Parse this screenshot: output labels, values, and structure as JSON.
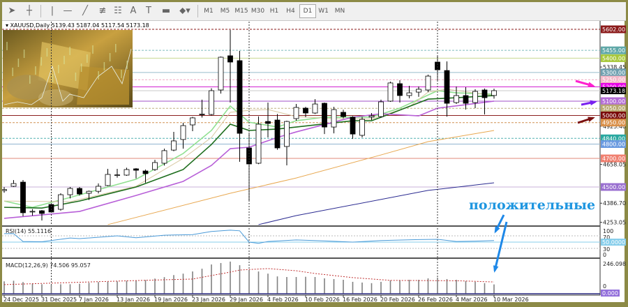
{
  "toolbar": {
    "tools": [
      {
        "icon": "cursor-arrow-icon",
        "glyph": "➤"
      },
      {
        "icon": "crosshair-icon",
        "glyph": "┼"
      },
      {
        "icon": "vertical-line-icon",
        "glyph": "|"
      },
      {
        "icon": "horizontal-line-icon",
        "glyph": "—"
      },
      {
        "icon": "trend-line-icon",
        "glyph": "╱"
      },
      {
        "icon": "fibonacci-channel-icon",
        "glyph": "≢"
      },
      {
        "icon": "fibonacci-grid-icon",
        "glyph": "☷"
      },
      {
        "icon": "text-icon",
        "glyph": "A"
      },
      {
        "icon": "text-label-icon",
        "glyph": "T"
      },
      {
        "icon": "rectangle-icon",
        "glyph": "▬"
      },
      {
        "icon": "shapes-dropdown-icon",
        "glyph": "⬥▾"
      }
    ],
    "timeframes": [
      "M1",
      "M5",
      "M15",
      "M30",
      "H1",
      "H4",
      "D1",
      "W1",
      "MN"
    ],
    "selected_timeframe": "D1"
  },
  "chart_header": {
    "symbol": "XAUUSD,Daily",
    "ohlc": "5139.43 5187.04 5117.54 5173.18"
  },
  "annotation": {
    "text": "положительные",
    "color": "#1e96e0"
  },
  "colors": {
    "bull_fill": "#ffffff",
    "bear_fill": "#000000",
    "candle_stroke": "#000000",
    "background": "#ffffff",
    "frame": "#8c8a46"
  },
  "price_axis": {
    "ticks": [
      "5338.45",
      "4925.40",
      "4658.05",
      "4386.70",
      "4253.05"
    ],
    "current_price": {
      "value": 5173.18,
      "label": "5173.18",
      "color": "#000000",
      "line": "#c8c8c8"
    }
  },
  "levels": [
    {
      "value": 5602,
      "label": "5602.00",
      "color": "#8b1a1a",
      "line": "#8b1a1a",
      "dash": true
    },
    {
      "value": 5455,
      "label": "5455.00",
      "color": "#5fa8a8",
      "line": "#7fbcbc",
      "dash": true
    },
    {
      "value": 5400,
      "label": "5400.00",
      "color": "#a8c83c",
      "line": "#c8d890",
      "dash": false
    },
    {
      "value": 5300,
      "label": "5300.00",
      "color": "#6fa0b0",
      "line": "#98bccb",
      "dash": false
    },
    {
      "value": 5250,
      "label": "5250.00",
      "color": "#f4b8c8",
      "line": "#f0a8c0",
      "dash": true
    },
    {
      "value": 5200,
      "label": "5200.00",
      "color": "#e600e6",
      "line": "#d020d0",
      "dash": false
    },
    {
      "value": 5100,
      "label": "5100.00",
      "color": "#b36bd6",
      "line": "#a050c8",
      "dash": false
    },
    {
      "value": 5050,
      "label": "5050.00",
      "color": "#b8a870",
      "line": "#c0b080",
      "dash": true
    },
    {
      "value": 5000,
      "label": "5000.00",
      "color": "#7a0a0a",
      "line": "#8b2020",
      "dash": false
    },
    {
      "value": 4950,
      "label": "4950.00",
      "color": "#d9904a",
      "line": "#d09050",
      "dash": true
    },
    {
      "value": 4840,
      "label": "4840.00",
      "color": "#2aa8a0",
      "line": "#50b0b0",
      "dash": true
    },
    {
      "value": 4800,
      "label": "4800.00",
      "color": "#6a9ae0",
      "line": "#90b4d0",
      "dash": false
    },
    {
      "value": 4700,
      "label": "4700.00",
      "color": "#f08070",
      "line": "#e08878",
      "dash": false
    },
    {
      "value": 4500,
      "label": "4500.00",
      "color": "#9a70d0",
      "line": "#c8b0d8",
      "dash": false
    }
  ],
  "chart_data": {
    "type": "candlestick",
    "ylim": [
      4253.05,
      5602
    ],
    "date_labels": [
      {
        "date": "2025-12-24",
        "label": "24 Dec 2025"
      },
      {
        "date": "2025-12-31",
        "label": "31 Dec 2025"
      },
      {
        "date": "2026-01-07",
        "label": "7 Jan 2026"
      },
      {
        "date": "2026-01-13",
        "label": "13 Jan 2026"
      },
      {
        "date": "2026-01-19",
        "label": "19 Jan 2026"
      },
      {
        "date": "2026-01-23",
        "label": "23 Jan 2026"
      },
      {
        "date": "2026-01-29",
        "label": "29 Jan 2026"
      },
      {
        "date": "2026-02-04",
        "label": "4 Feb 2026"
      },
      {
        "date": "2026-02-10",
        "label": "10 Feb 2026"
      },
      {
        "date": "2026-02-16",
        "label": "16 Feb 2026"
      },
      {
        "date": "2026-02-20",
        "label": "20 Feb 2026"
      },
      {
        "date": "2026-02-26",
        "label": "26 Feb 2026"
      },
      {
        "date": "2026-03-04",
        "label": "4 Mar 2026"
      },
      {
        "date": "2026-03-10",
        "label": "10 Mar 2026"
      }
    ],
    "period_separators": [
      "2026-01-02",
      "2026-02-02",
      "2026-03-02"
    ],
    "candles": [
      [
        "2025-12-24",
        4475,
        4500,
        4460,
        4482
      ],
      [
        "2025-12-26",
        4505,
        4548,
        4500,
        4524
      ],
      [
        "2025-12-29",
        4534,
        4549,
        4295,
        4320
      ],
      [
        "2025-12-30",
        4325,
        4345,
        4300,
        4330
      ],
      [
        "2025-12-31",
        4334,
        4340,
        4266,
        4315
      ],
      [
        "2026-01-02",
        4378,
        4385,
        4320,
        4325
      ],
      [
        "2026-01-05",
        4344,
        4456,
        4335,
        4446
      ],
      [
        "2026-01-06",
        4446,
        4500,
        4420,
        4490
      ],
      [
        "2026-01-07",
        4490,
        4500,
        4440,
        4451
      ],
      [
        "2026-01-08",
        4456,
        4475,
        4410,
        4470
      ],
      [
        "2026-01-09",
        4470,
        4525,
        4455,
        4505
      ],
      [
        "2026-01-12",
        4510,
        4627,
        4505,
        4588
      ],
      [
        "2026-01-13",
        4580,
        4627,
        4565,
        4585
      ],
      [
        "2026-01-14",
        4583,
        4635,
        4578,
        4622
      ],
      [
        "2026-01-15",
        4627,
        4632,
        4560,
        4617
      ],
      [
        "2026-01-16",
        4612,
        4622,
        4530,
        4593
      ],
      [
        "2026-01-19",
        4622,
        4690,
        4612,
        4671
      ],
      [
        "2026-01-20",
        4666,
        4768,
        4650,
        4754
      ],
      [
        "2026-01-21",
        4758,
        4885,
        4750,
        4822
      ],
      [
        "2026-01-22",
        4832,
        4948,
        4768,
        4929
      ],
      [
        "2026-01-23",
        4934,
        4990,
        4890,
        4983
      ],
      [
        "2026-01-26",
        5005,
        5110,
        4985,
        5010
      ],
      [
        "2026-01-27",
        5007,
        5190,
        5000,
        5173
      ],
      [
        "2026-01-28",
        5178,
        5412,
        5153,
        5407
      ],
      [
        "2026-01-29",
        5417,
        5597,
        5090,
        5373
      ],
      [
        "2026-01-30",
        5383,
        5451,
        4676,
        4875
      ],
      [
        "2026-02-02",
        4773,
        4880,
        4402,
        4661
      ],
      [
        "2026-02-03",
        4666,
        4993,
        4660,
        4939
      ],
      [
        "2026-02-04",
        4958,
        5090,
        4846,
        4944
      ],
      [
        "2026-02-05",
        4968,
        5010,
        4760,
        4773
      ],
      [
        "2026-02-06",
        4783,
        4963,
        4651,
        4958
      ],
      [
        "2026-02-09",
        4978,
        5080,
        4963,
        5056
      ],
      [
        "2026-02-10",
        5051,
        5060,
        4988,
        5017
      ],
      [
        "2026-02-11",
        5017,
        5114,
        5010,
        5080
      ],
      [
        "2026-02-12",
        5085,
        5090,
        4870,
        4919
      ],
      [
        "2026-02-13",
        4919,
        5060,
        4875,
        5041
      ],
      [
        "2026-02-16",
        5022,
        5040,
        4980,
        4992
      ],
      [
        "2026-02-17",
        4988,
        4995,
        4836,
        4870
      ],
      [
        "2026-02-18",
        4861,
        4990,
        4846,
        4973
      ],
      [
        "2026-02-19",
        4988,
        5017,
        4968,
        4997
      ],
      [
        "2026-02-20",
        4992,
        5110,
        4985,
        5095
      ],
      [
        "2026-02-23",
        5100,
        5236,
        5095,
        5227
      ],
      [
        "2026-02-24",
        5222,
        5246,
        5090,
        5139
      ],
      [
        "2026-02-25",
        5139,
        5207,
        5120,
        5158
      ],
      [
        "2026-02-26",
        5163,
        5202,
        5130,
        5183
      ],
      [
        "2026-02-27",
        5178,
        5285,
        5163,
        5275
      ],
      [
        "2026-03-02",
        5373,
        5417,
        5246,
        5319
      ],
      [
        "2026-03-03",
        5314,
        5378,
        4992,
        5085
      ],
      [
        "2026-03-04",
        5090,
        5202,
        5080,
        5139
      ],
      [
        "2026-03-05",
        5139,
        5197,
        5041,
        5085
      ],
      [
        "2026-03-06",
        5090,
        5183,
        5051,
        5168
      ],
      [
        "2026-03-09",
        5178,
        5188,
        5007,
        5124
      ],
      [
        "2026-03-10",
        5139.43,
        5187.04,
        5117.54,
        5173.18
      ]
    ],
    "moving_averages": [
      {
        "color": "#90e090",
        "width": 1.6,
        "points": [
          [
            "2025-12-24",
            4402
          ],
          [
            "2025-12-30",
            4358
          ],
          [
            "2026-01-06",
            4427
          ],
          [
            "2026-01-15",
            4554
          ],
          [
            "2026-01-22",
            4734
          ],
          [
            "2026-01-27",
            4895
          ],
          [
            "2026-01-29",
            5066
          ],
          [
            "2026-02-02",
            4953
          ],
          [
            "2026-02-05",
            4919
          ],
          [
            "2026-02-09",
            4963
          ],
          [
            "2026-02-12",
            4988
          ],
          [
            "2026-02-19",
            4988
          ],
          [
            "2026-02-24",
            5051
          ],
          [
            "2026-03-02",
            5173
          ],
          [
            "2026-03-04",
            5158
          ],
          [
            "2026-03-10",
            5148
          ]
        ]
      },
      {
        "color": "#d8c8a0",
        "width": 1,
        "points": [
          [
            "2025-12-24",
            4402
          ],
          [
            "2026-01-06",
            4397
          ],
          [
            "2026-01-15",
            4505
          ],
          [
            "2026-01-22",
            4700
          ],
          [
            "2026-01-27",
            4846
          ],
          [
            "2026-01-29",
            5022
          ],
          [
            "2026-02-02",
            5036
          ],
          [
            "2026-02-04",
            5041
          ],
          [
            "2026-02-09",
            4992
          ],
          [
            "2026-02-13",
            4978
          ],
          [
            "2026-02-19",
            4975
          ],
          [
            "2026-02-25",
            5060
          ],
          [
            "2026-02-27",
            5163
          ],
          [
            "2026-03-03",
            5183
          ],
          [
            "2026-03-10",
            5139
          ]
        ]
      },
      {
        "color": "#1e6e1e",
        "width": 1.6,
        "points": [
          [
            "2025-12-24",
            4358
          ],
          [
            "2025-12-31",
            4353
          ],
          [
            "2026-01-07",
            4402
          ],
          [
            "2026-01-15",
            4500
          ],
          [
            "2026-01-22",
            4622
          ],
          [
            "2026-01-27",
            4797
          ],
          [
            "2026-01-29",
            4939
          ],
          [
            "2026-02-02",
            4895
          ],
          [
            "2026-02-05",
            4905
          ],
          [
            "2026-02-09",
            4919
          ],
          [
            "2026-02-17",
            4963
          ],
          [
            "2026-02-19",
            4963
          ],
          [
            "2026-02-23",
            5012
          ],
          [
            "2026-02-27",
            5114
          ],
          [
            "2026-03-04",
            5124
          ],
          [
            "2026-03-10",
            5139
          ]
        ]
      },
      {
        "color": "#b860d8",
        "width": 1.6,
        "points": [
          [
            "2025-12-24",
            4281
          ],
          [
            "2026-01-07",
            4329
          ],
          [
            "2026-01-15",
            4441
          ],
          [
            "2026-01-22",
            4539
          ],
          [
            "2026-01-27",
            4651
          ],
          [
            "2026-01-29",
            4768
          ],
          [
            "2026-02-02",
            4778
          ],
          [
            "2026-02-05",
            4846
          ],
          [
            "2026-02-09",
            4885
          ],
          [
            "2026-02-17",
            4988
          ],
          [
            "2026-02-20",
            5012
          ],
          [
            "2026-02-26",
            4997
          ],
          [
            "2026-03-02",
            5051
          ],
          [
            "2026-03-05",
            5075
          ],
          [
            "2026-03-10",
            5100
          ]
        ]
      },
      {
        "color": "#e8a850",
        "width": 1,
        "points": [
          [
            "2026-01-12",
            4237
          ],
          [
            "2026-01-29",
            4456
          ],
          [
            "2026-02-09",
            4563
          ],
          [
            "2026-02-20",
            4724
          ],
          [
            "2026-02-27",
            4817
          ],
          [
            "2026-03-10",
            4895
          ]
        ]
      },
      {
        "color": "#2a2a90",
        "width": 1,
        "points": [
          [
            "2026-02-03",
            4237
          ],
          [
            "2026-02-09",
            4300
          ],
          [
            "2026-02-27",
            4476
          ],
          [
            "2026-03-10",
            4529
          ]
        ]
      }
    ],
    "rsi": {
      "label": "RSI(14) 55.1116",
      "levels": [
        "100",
        "70",
        "30",
        "0"
      ],
      "mid_label": "50.0000",
      "color": "#4a9ad8",
      "points": [
        [
          "2025-12-24",
          77
        ],
        [
          "2025-12-26",
          77
        ],
        [
          "2025-12-29",
          52
        ],
        [
          "2025-12-31",
          51
        ],
        [
          "2026-01-06",
          63
        ],
        [
          "2026-01-07",
          61
        ],
        [
          "2026-01-13",
          70
        ],
        [
          "2026-01-15",
          64
        ],
        [
          "2026-01-20",
          72
        ],
        [
          "2026-01-23",
          74
        ],
        [
          "2026-01-27",
          84
        ],
        [
          "2026-01-29",
          88
        ],
        [
          "2026-01-30",
          86
        ],
        [
          "2026-02-02",
          50
        ],
        [
          "2026-02-03",
          46
        ],
        [
          "2026-02-04",
          52
        ],
        [
          "2026-02-09",
          57
        ],
        [
          "2026-02-12",
          54
        ],
        [
          "2026-02-17",
          50
        ],
        [
          "2026-02-20",
          55
        ],
        [
          "2026-02-26",
          58
        ],
        [
          "2026-03-02",
          59
        ],
        [
          "2026-03-04",
          52
        ],
        [
          "2026-03-06",
          53
        ],
        [
          "2026-03-10",
          55.11
        ]
      ]
    },
    "macd": {
      "label": "MACD(12,26,9) 74.506 95.057",
      "max_label": "246.098",
      "zero_label": "0",
      "value_label": "0.000",
      "ylim": [
        0,
        246.098
      ],
      "histogram": [
        100,
        105,
        94,
        82,
        76,
        70,
        76,
        76,
        80,
        88,
        94,
        96,
        100,
        105,
        108,
        111,
        123,
        135,
        152,
        164,
        182,
        205,
        240,
        252,
        264,
        234,
        193,
        182,
        164,
        141,
        136,
        136,
        138,
        136,
        125,
        119,
        113,
        96,
        90,
        85,
        96,
        108,
        110,
        113,
        113,
        125,
        131,
        119,
        113,
        102,
        96,
        85,
        74.506
      ],
      "signal": [
        [
          "2025-12-24",
          73
        ],
        [
          "2026-01-06",
          90
        ],
        [
          "2026-01-13",
          102
        ],
        [
          "2026-01-20",
          113
        ],
        [
          "2026-01-23",
          119
        ],
        [
          "2026-01-27",
          148
        ],
        [
          "2026-01-29",
          177
        ],
        [
          "2026-01-30",
          194
        ],
        [
          "2026-02-04",
          206
        ],
        [
          "2026-02-09",
          188
        ],
        [
          "2026-02-11",
          165
        ],
        [
          "2026-02-17",
          131
        ],
        [
          "2026-02-23",
          108
        ],
        [
          "2026-03-04",
          105
        ],
        [
          "2026-03-10",
          95.057
        ]
      ]
    }
  }
}
